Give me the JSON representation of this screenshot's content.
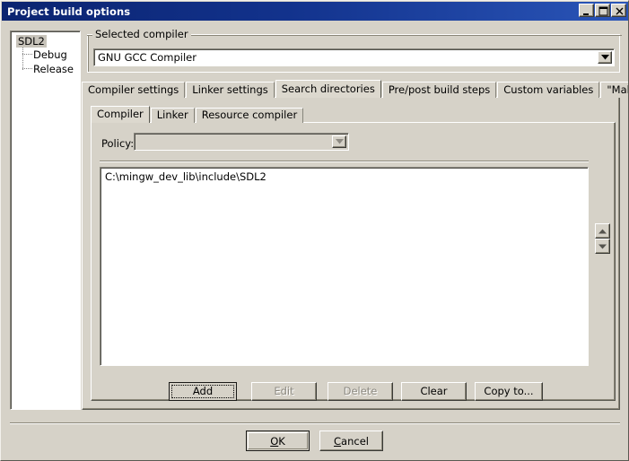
{
  "window": {
    "title": "Project build options",
    "controls": [
      {
        "name": "minimize",
        "glyph": "minimize-icon"
      },
      {
        "name": "maximize",
        "glyph": "maximize-icon"
      },
      {
        "name": "close",
        "glyph": "close-icon"
      }
    ]
  },
  "tree": {
    "root": {
      "label": "SDL2",
      "selected": true
    },
    "children": [
      {
        "label": "Debug"
      },
      {
        "label": "Release"
      }
    ]
  },
  "compiler_group": {
    "legend": "Selected compiler",
    "selected": "GNU GCC Compiler",
    "dropdown_icon": "chevron-down-icon"
  },
  "outer_tabs": [
    {
      "label": "Compiler settings",
      "active": false
    },
    {
      "label": "Linker settings",
      "active": false
    },
    {
      "label": "Search directories",
      "active": true
    },
    {
      "label": "Pre/post build steps",
      "active": false
    },
    {
      "label": "Custom variables",
      "active": false
    },
    {
      "label": "\"Make\" commands",
      "active": false
    }
  ],
  "inner_tabs": [
    {
      "label": "Compiler",
      "active": true
    },
    {
      "label": "Linker",
      "active": false
    },
    {
      "label": "Resource compiler",
      "active": false
    }
  ],
  "policy": {
    "label": "Policy:",
    "value": "",
    "placeholder": "",
    "disabled": true,
    "dropdown_icon": "chevron-down-icon"
  },
  "directories": {
    "items": [
      "C:\\mingw_dev_lib\\include\\SDL2"
    ]
  },
  "order_buttons": [
    {
      "name": "move-up",
      "icon": "arrow-up-icon"
    },
    {
      "name": "move-down",
      "icon": "arrow-down-icon"
    }
  ],
  "action_buttons": [
    {
      "label": "Add",
      "disabled": false,
      "focused": true
    },
    {
      "label": "Edit",
      "disabled": true,
      "focused": false
    },
    {
      "label": "Delete",
      "disabled": true,
      "focused": false
    },
    {
      "label": "Clear",
      "disabled": false,
      "focused": false
    },
    {
      "label": "Copy to...",
      "disabled": false,
      "focused": false
    }
  ],
  "dialog_buttons": {
    "ok": {
      "accel": "O",
      "rest": "K",
      "default": true
    },
    "cancel": {
      "accel": "C",
      "rest": "ancel",
      "default": false
    }
  },
  "colors": {
    "face": "#d6d2c8",
    "title_start": "#0b2470",
    "title_end": "#2a55b8",
    "text": "#000000",
    "disabled_text": "#8d8a82",
    "field_bg": "#ffffff",
    "selection_bg": "#c8c4bb"
  }
}
